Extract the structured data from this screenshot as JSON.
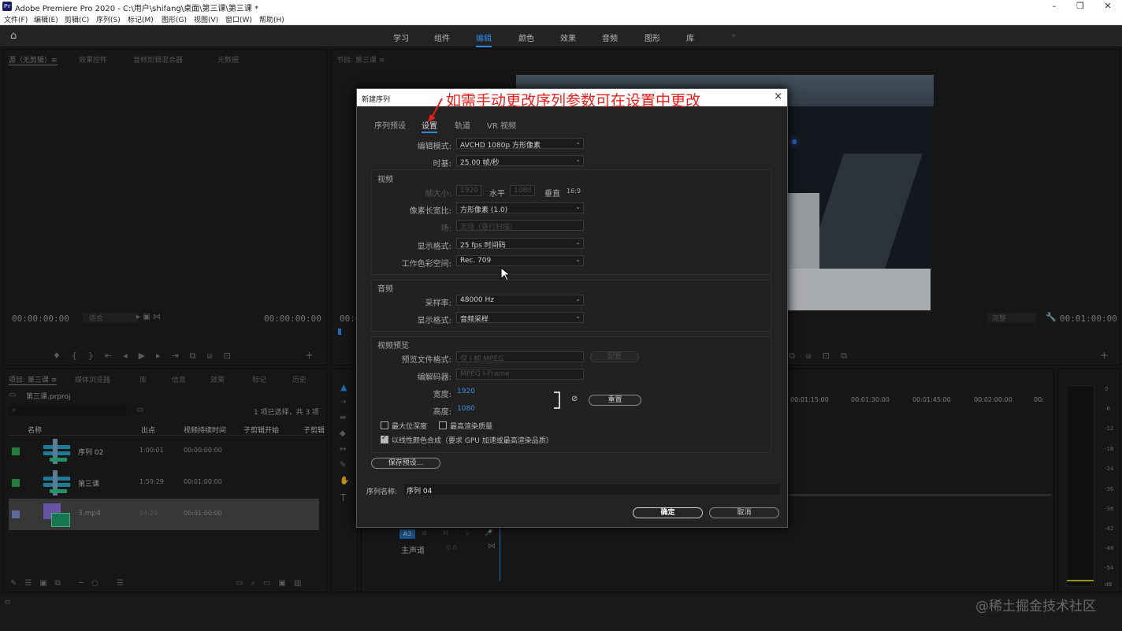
{
  "window": {
    "title": "Adobe Premiere Pro 2020 - C:\\用户\\shifang\\桌面\\第三课\\第三课 *",
    "logo": "Pr"
  },
  "menu": [
    "文件(F)",
    "编辑(E)",
    "剪辑(C)",
    "序列(S)",
    "标记(M)",
    "图形(G)",
    "视图(V)",
    "窗口(W)",
    "帮助(H)"
  ],
  "workspaces": [
    "学习",
    "组件",
    "编辑",
    "颜色",
    "效果",
    "音频",
    "图形",
    "库"
  ],
  "workspace_more": "»",
  "source_panel": {
    "tabs": [
      "源（无剪辑）≡",
      "效果控件",
      "音频剪辑混合器",
      "元数据"
    ],
    "tc_left": "00:00:00:00",
    "fit": "适合",
    "tc_right": "00:00:00:00"
  },
  "program_panel": {
    "tab": "节目: 第三课 ≡",
    "tc_left": "00:0",
    "fit": "完整",
    "tc_right": "00:01:00:00"
  },
  "project_panel": {
    "tabs": [
      "项目: 第三课 ≡",
      "媒体浏览器",
      "库",
      "信息",
      "效果",
      "标记",
      "历史"
    ],
    "file": "第三课.prproj",
    "selection": "1 项已选择，共 3 项",
    "headers": [
      "名称",
      "出点",
      "视频持续时间",
      "子剪辑开始",
      "子剪辑"
    ],
    "rows": [
      {
        "name": "序列 02",
        "out": "1:00:01",
        "dur": "00:00:00:00",
        "color": "#2fa84f"
      },
      {
        "name": "第三课",
        "out": "1:59:29",
        "dur": "00:01:00:00",
        "color": "#2fa84f"
      },
      {
        "name": "3.mp4",
        "out": "04:29",
        "dur": "00:01:00:00",
        "color": "#7b8fd6"
      }
    ]
  },
  "timeline": {
    "ruler": [
      "00:01:15:00",
      "00:01:30:00",
      "00:01:45:00",
      "00:02:00:00",
      "00:"
    ],
    "tracks": [
      {
        "label": "A3"
      },
      {
        "label": "主声道",
        "value": "0.0"
      }
    ]
  },
  "meter": {
    "labels": [
      "0",
      "-6",
      "-12",
      "-18",
      "-24",
      "-30",
      "-36",
      "-42",
      "-48",
      "-54",
      "dB"
    ]
  },
  "dialog": {
    "title": "新建序列",
    "close": "×",
    "annotation": "如需手动更改序列参数可在设置中更改",
    "tabs": [
      "序列预设",
      "设置",
      "轨道",
      "VR 视频"
    ],
    "edit_mode": {
      "label": "编辑模式:",
      "value": "AVCHD 1080p 方形像素"
    },
    "timebase": {
      "label": "时基:",
      "value": "25.00  帧/秒"
    },
    "video": {
      "title": "视频",
      "frame_size_label": "帧大小:",
      "frame_w": "1920",
      "horizontal": "水平",
      "frame_h": "1080",
      "vertical": "垂直",
      "ratio": "16:9",
      "pixel_aspect": {
        "label": "像素长宽比:",
        "value": "方形像素 (1.0)"
      },
      "field": {
        "label": "场:",
        "value": "无场（逐行扫描）"
      },
      "display_format": {
        "label": "显示格式:",
        "value": "25 fps 时间码"
      },
      "color_space": {
        "label": "工作色彩空间:",
        "value": "Rec. 709"
      }
    },
    "audio": {
      "title": "音频",
      "sample_rate": {
        "label": "采样率:",
        "value": "48000 Hz"
      },
      "display_format": {
        "label": "显示格式:",
        "value": "音频采样"
      }
    },
    "preview": {
      "title": "视频预览",
      "file_format": {
        "label": "预览文件格式:",
        "value": "仅 I 帧 MPEG"
      },
      "config": "配置",
      "codec": {
        "label": "编解码器:",
        "value": "MPEG I-Frame"
      },
      "width": {
        "label": "宽度:",
        "value": "1920"
      },
      "height": {
        "label": "高度:",
        "value": "1080"
      },
      "reset": "重置",
      "max_bit_depth": "最大位深度",
      "max_render_quality": "最高渲染质量",
      "linear_color": "以线性颜色合成（要求 GPU 加速或最高渲染品质）"
    },
    "save_preset": "保存预设...",
    "seq_name_label": "序列名称:",
    "seq_name": "序列 04",
    "ok": "确定",
    "cancel": "取消"
  },
  "watermark": "@稀土掘金技术社区"
}
